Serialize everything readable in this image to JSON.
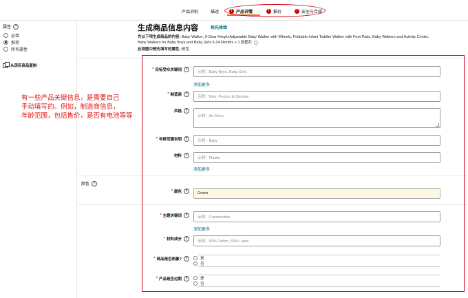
{
  "tabs": [
    {
      "label": "产品识别",
      "error": false,
      "active": false
    },
    {
      "label": "描述",
      "error": false,
      "active": false
    },
    {
      "label": "产品详情",
      "error": true,
      "active": true
    },
    {
      "label": "报价",
      "error": true,
      "active": false
    },
    {
      "label": "安全与合规",
      "error": true,
      "active": false
    }
  ],
  "error_mark": "!",
  "left": {
    "attr_title": "属性",
    "radios": [
      {
        "label": "必填",
        "selected": false
      },
      {
        "label": "推荐",
        "selected": true
      },
      {
        "label": "所有属性",
        "selected": false
      }
    ],
    "copy_label": "从现有商品复制"
  },
  "gen": {
    "title": "生成商品信息内容",
    "link": "抢先体验",
    "desc_lead": "为以下项生成商品的内容:",
    "desc_text": "Baby Walker, 9-Gear Height Adjustable Baby Walker with Wheels, Foldable Infant Toddler Walker with Foot Pads, Baby Walkers and Activity Center, Baby Walkers for Baby Boys and Baby Girls 6-24 Months + 1 张图片",
    "req_lead": "此视图中预先填写的属性:",
    "req_value": "颜色"
  },
  "annotation": {
    "lines": [
      "有一些产品关键信息，是需要自己",
      "手动填写的。例如，制造商信息，",
      "年龄范围，包括售价，是否有电池等等"
    ]
  },
  "section_color_label": "颜色",
  "help_glyph": "?",
  "fields": {
    "target_audience": {
      "label": "目标受众关键词",
      "required": true,
      "placeholder": "示例：Baby Boys, Baby Girls",
      "add_more": "添加更多"
    },
    "manufacturer": {
      "label": "制造商",
      "required": true,
      "placeholder": "示例：Nike, Procter & Gamble"
    },
    "style": {
      "label": "风格",
      "required": false,
      "placeholder": "示例：Art Deco"
    },
    "age_range": {
      "label": "年龄范围说明",
      "required": true,
      "placeholder": "示例：Baby"
    },
    "material": {
      "label": "材料",
      "required": false,
      "placeholder": "示例：Plastic",
      "add_more": "添加更多"
    },
    "color": {
      "label": "颜色",
      "required": true,
      "value": "Green"
    },
    "theme": {
      "label": "主题关键词",
      "required": true,
      "placeholder": "示例：Construction",
      "add_more": "添加更多"
    },
    "fabric": {
      "label": "材料成分",
      "required": true,
      "placeholder": "示例：50% Cotton, 50% Latex"
    },
    "heat_sensitive": {
      "label": "商品是否热敏?",
      "required": true,
      "options": [
        "是",
        "否"
      ]
    },
    "expired": {
      "label": "产品是否过期",
      "required": true,
      "options": [
        "是",
        "否"
      ]
    }
  },
  "colors": {
    "accent": "#e77600",
    "error": "#c40000",
    "annotation": "#d0021b",
    "link": "#007185"
  }
}
